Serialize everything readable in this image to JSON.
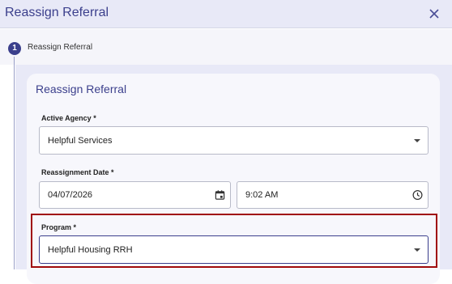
{
  "header": {
    "title": "Reassign Referral",
    "close_icon": "close-icon"
  },
  "stepper": {
    "step_number": "1",
    "step_label": "Reassign Referral"
  },
  "form": {
    "title": "Reassign Referral",
    "active_agency": {
      "label": "Active Agency *",
      "value": "Helpful Services"
    },
    "reassignment_date": {
      "label": "Reassignment Date *",
      "date_value": "04/07/2026",
      "time_value": "9:02 AM",
      "date_icon": "calendar-icon",
      "time_icon": "clock-icon"
    },
    "program": {
      "label": "Program *",
      "value": "Helpful Housing RRH"
    }
  },
  "colors": {
    "accent": "#3b3f8c",
    "header_bg": "#e8e9f7",
    "highlight": "#a00b0b"
  }
}
